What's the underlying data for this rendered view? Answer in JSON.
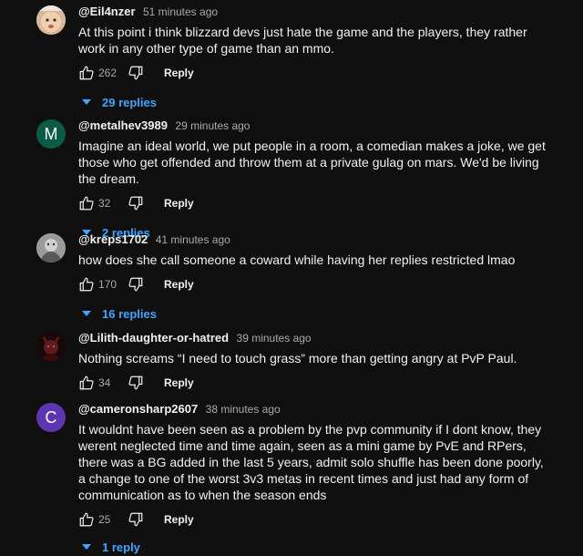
{
  "comments": [
    {
      "author": "@Eil4nzer",
      "time": "51 minutes ago",
      "text": "At this point i think blizzard devs just hate the game and the players, they rather work in any other type of game than an mmo.",
      "likes": "262",
      "reply": "Reply",
      "replies": "29 replies",
      "avatar_color": "#c9a88a"
    },
    {
      "author": "@metalhev3989",
      "time": "29 minutes ago",
      "text": "Imagine an ideal world, we put people in a room, a comedian makes a joke, we get those who get offended and throw them at a private gulag on mars. We'd be living the dream.",
      "likes": "32",
      "reply": "Reply",
      "replies": "2 replies",
      "avatar_letter": "M",
      "avatar_color": "#0b5a45"
    },
    {
      "author": "@kreps1702",
      "time": "41 minutes ago",
      "text": "how does she call someone a coward while having her replies restricted lmao",
      "likes": "170",
      "reply": "Reply",
      "replies": "16 replies",
      "avatar_color": "#8a8a8a"
    },
    {
      "author": "@Lilith-daughter-or-hatred",
      "time": "39 minutes ago",
      "text": "Nothing screams “I need to touch grass” more than getting angry at PvP Paul.",
      "likes": "34",
      "reply": "Reply",
      "avatar_color": "#3a1212"
    },
    {
      "author": "@cameronsharp2607",
      "time": "38 minutes ago",
      "text": "It wouldnt have been seen as a problem by the pvp community if I dont know, they werent neglected time and time again, seen as a mini game by PvE and RPers, there was a BG added in the last 5 years, admit solo shuffle has been done poorly, a change to one of the worst 3v3 metas in recent times and just had any form of communication as to when the season ends",
      "likes": "25",
      "reply": "Reply",
      "replies": "1 reply",
      "avatar_letter": "C",
      "avatar_color": "#5e35b1"
    }
  ]
}
